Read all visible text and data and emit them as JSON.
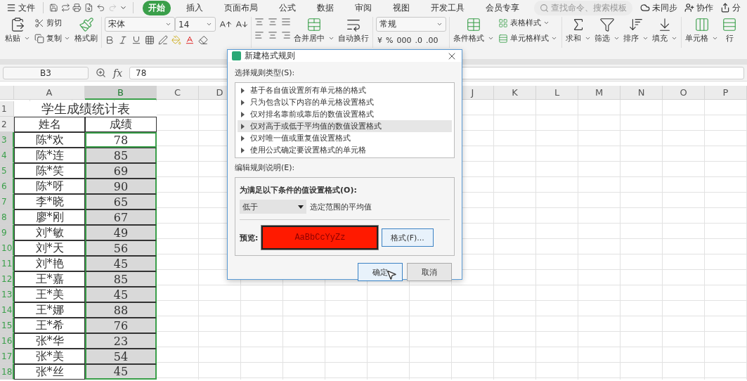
{
  "menu_bar": {
    "file": "文件",
    "tabs": [
      {
        "label": "开始",
        "selected": true
      },
      {
        "label": "插入",
        "selected": false
      },
      {
        "label": "页面布局",
        "selected": false
      },
      {
        "label": "公式",
        "selected": false
      },
      {
        "label": "数据",
        "selected": false
      },
      {
        "label": "审阅",
        "selected": false
      },
      {
        "label": "视图",
        "selected": false
      },
      {
        "label": "开发工具",
        "selected": false
      },
      {
        "label": "会员专享",
        "selected": false
      }
    ],
    "search": {
      "placeholder": "查找命令、搜索模板"
    },
    "actions": [
      "未同步",
      "协作",
      "分"
    ]
  },
  "ribbon": {
    "paste": "粘贴",
    "cut": "剪切",
    "copy": "复制",
    "format_painter": "格式刷",
    "font": {
      "name": "宋体",
      "size": "14"
    },
    "merge": "合并居中",
    "wrap": "自动换行",
    "number_format": "常规",
    "number_buttons": [
      "¥",
      "%",
      "000",
      ".0",
      ".00"
    ],
    "conditional_format": "条件格式",
    "table_style": "表格样式",
    "cell_style": "单元格样式",
    "sum": "求和",
    "filter": "筛选",
    "sort": "排序",
    "fill": "填充",
    "cell": "单元格",
    "row": "行"
  },
  "formula_bar": {
    "name_box": "B3",
    "fx": "fx",
    "value": "78"
  },
  "sheet": {
    "columns_left": [
      {
        "label": "A",
        "selected": false
      },
      {
        "label": "B",
        "selected": true
      },
      {
        "label": "C",
        "selected": false
      },
      {
        "label": "D",
        "selected": false
      }
    ],
    "columns_right": [
      {
        "label": "J",
        "selected": false
      },
      {
        "label": "K",
        "selected": false
      },
      {
        "label": "L",
        "selected": false
      },
      {
        "label": "M",
        "selected": false
      },
      {
        "label": "N",
        "selected": false
      },
      {
        "label": "O",
        "selected": false
      },
      {
        "label": "P",
        "selected": false
      }
    ],
    "title_row": {
      "number": "1",
      "text": "学生成绩统计表"
    },
    "header_row": {
      "number": "2",
      "name": "姓名",
      "score": "成绩"
    },
    "rows": [
      {
        "number": "3",
        "selected": true,
        "active": true,
        "name": "陈*欢",
        "score": "78"
      },
      {
        "number": "4",
        "selected": true,
        "active": false,
        "name": "陈*连",
        "score": "85"
      },
      {
        "number": "5",
        "selected": true,
        "active": false,
        "name": "陈*笑",
        "score": "69"
      },
      {
        "number": "6",
        "selected": true,
        "active": false,
        "name": "陈*呀",
        "score": "90"
      },
      {
        "number": "7",
        "selected": true,
        "active": false,
        "name": "李*晓",
        "score": "65"
      },
      {
        "number": "8",
        "selected": true,
        "active": false,
        "name": "廖*刚",
        "score": "67"
      },
      {
        "number": "9",
        "selected": true,
        "active": false,
        "name": "刘*敏",
        "score": "49"
      },
      {
        "number": "10",
        "selected": true,
        "active": false,
        "name": "刘*天",
        "score": "56"
      },
      {
        "number": "11",
        "selected": true,
        "active": false,
        "name": "刘*艳",
        "score": "45"
      },
      {
        "number": "12",
        "selected": true,
        "active": false,
        "name": "王*嘉",
        "score": "85"
      },
      {
        "number": "13",
        "selected": true,
        "active": false,
        "name": "王*美",
        "score": "45"
      },
      {
        "number": "14",
        "selected": true,
        "active": false,
        "name": "王*娜",
        "score": "88"
      },
      {
        "number": "15",
        "selected": true,
        "active": false,
        "name": "王*希",
        "score": "76"
      },
      {
        "number": "16",
        "selected": true,
        "active": false,
        "name": "张*华",
        "score": "23"
      },
      {
        "number": "17",
        "selected": true,
        "active": false,
        "name": "张*美",
        "score": "54"
      },
      {
        "number": "18",
        "selected": true,
        "active": false,
        "name": "张*丝",
        "score": "45"
      }
    ]
  },
  "dialog": {
    "title": "新建格式规则",
    "rule_type_label": "选择规则类型(S):",
    "rule_types": [
      {
        "label": "基于各自值设置所有单元格的格式",
        "selected": false
      },
      {
        "label": "只为包含以下内容的单元格设置格式",
        "selected": false
      },
      {
        "label": "仅对排名靠前或靠后的数值设置格式",
        "selected": false
      },
      {
        "label": "仅对高于或低于平均值的数值设置格式",
        "selected": true
      },
      {
        "label": "仅对唯一值或重复值设置格式",
        "selected": false
      },
      {
        "label": "使用公式确定要设置格式的单元格",
        "selected": false
      }
    ],
    "edit_label": "编辑规则说明(E):",
    "condition_label": "为满足以下条件的值设置格式(O):",
    "condition": {
      "value": "低于"
    },
    "condition_text": "选定范围的平均值",
    "preview_label": "预览:",
    "preview": {
      "text": "AaBbCcYyZz",
      "color": "#ff1a00"
    },
    "format_button": "格式(F)...",
    "ok": "确定",
    "cancel": "取消"
  }
}
